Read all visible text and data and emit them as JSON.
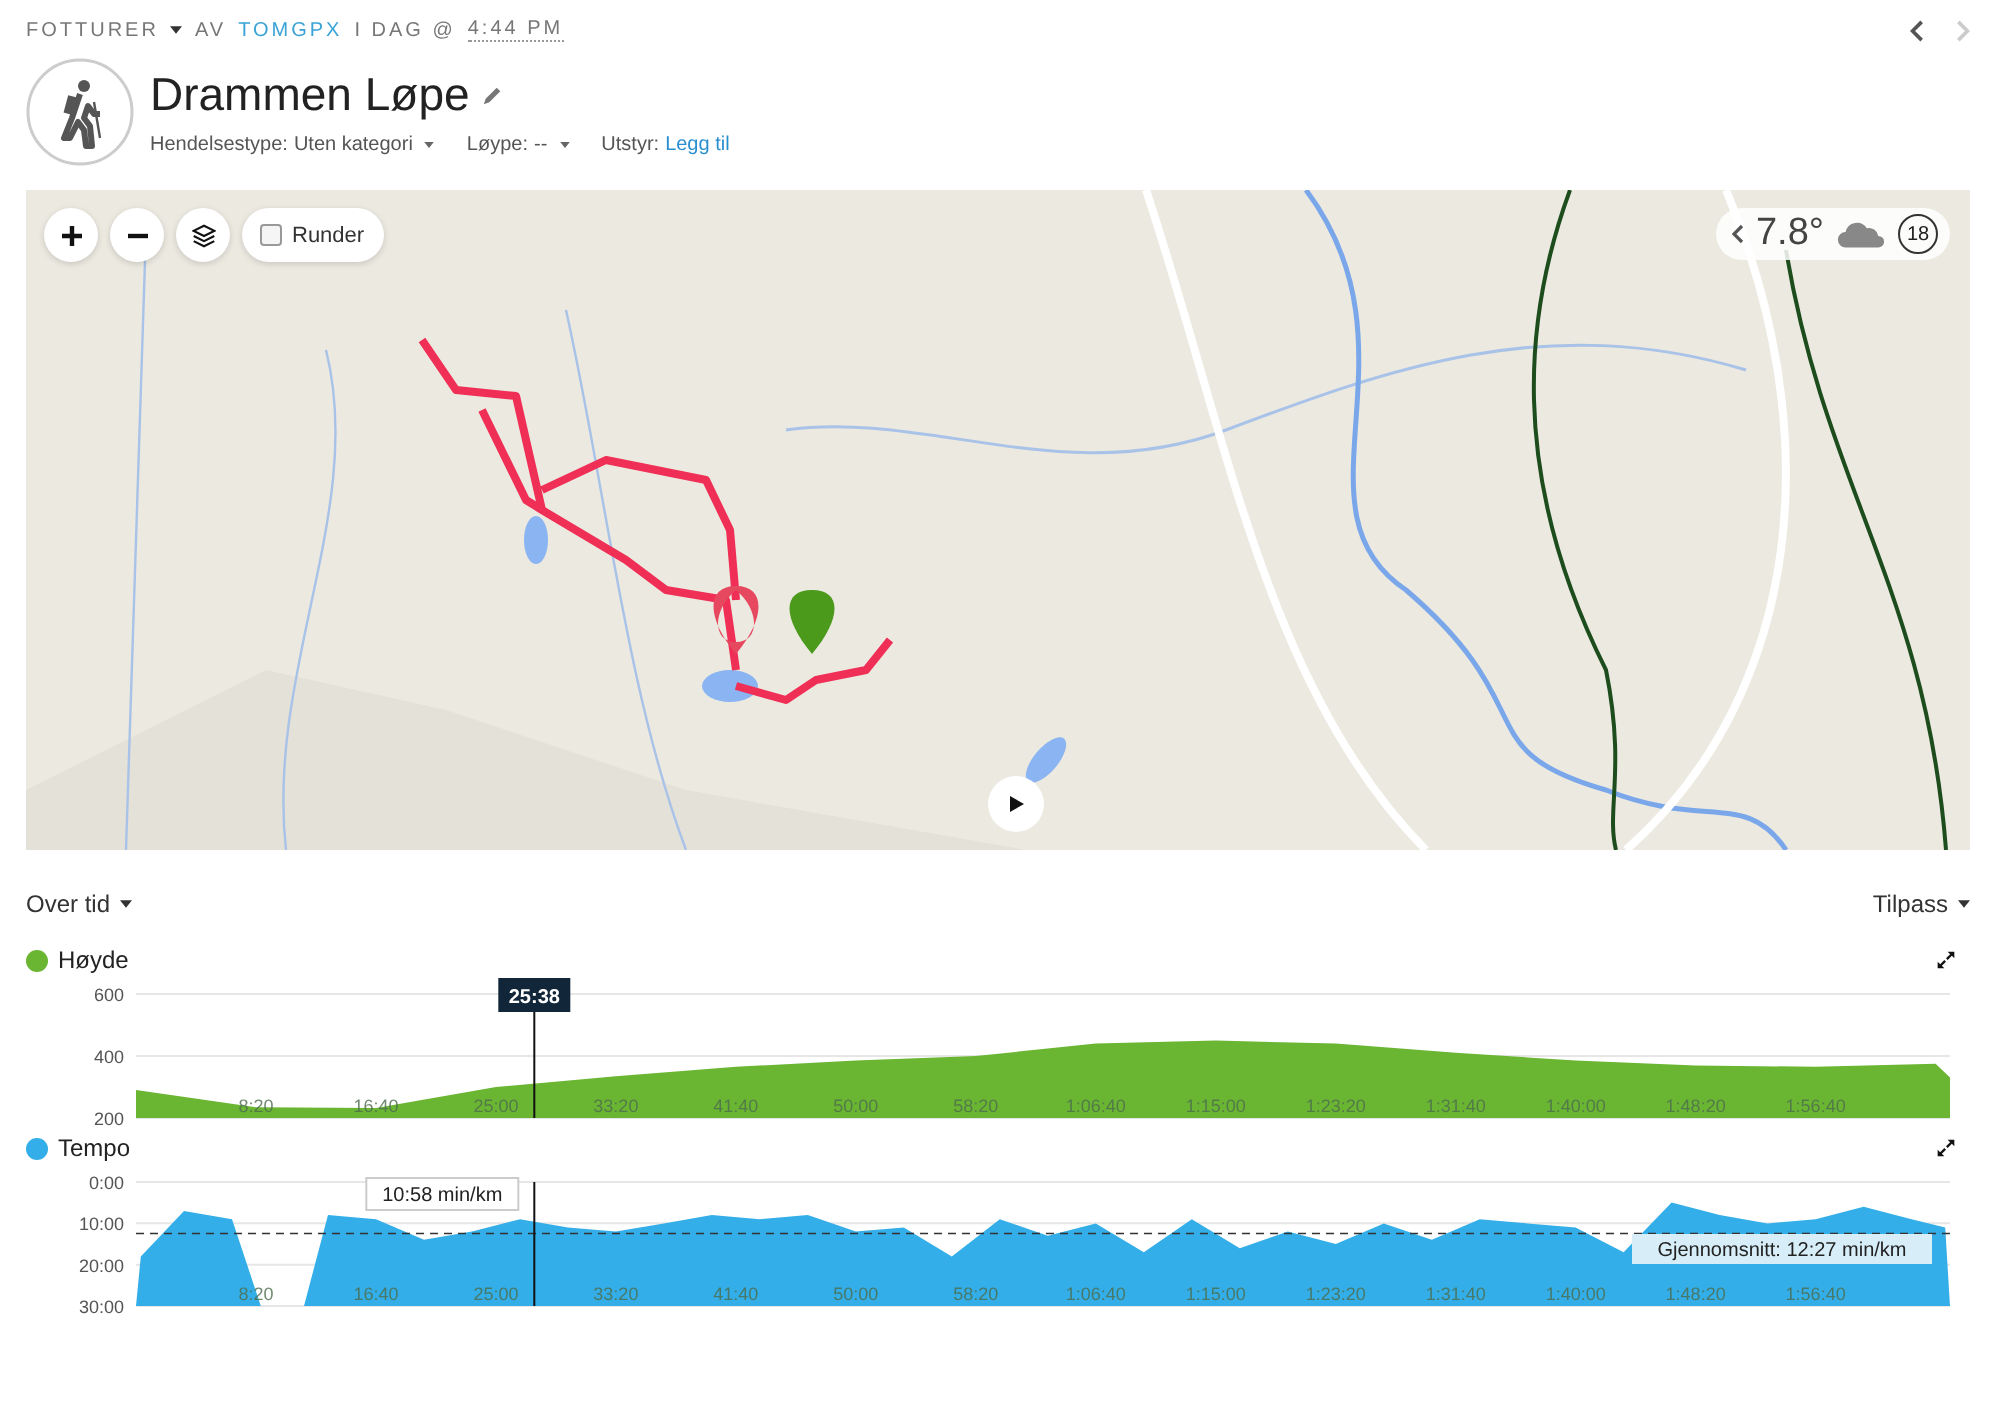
{
  "breadcrumb": {
    "category": "FOTTURER",
    "by": "AV",
    "user": "TOMGPX",
    "when": "I DAG @",
    "time": "4:44 PM"
  },
  "nav": {
    "previous_disabled": false,
    "next_disabled": true
  },
  "activity": {
    "title": "Drammen Løpe",
    "meta": [
      {
        "kind": "dropdown",
        "label": "Hendelsestype:",
        "value": "Uten kategori"
      },
      {
        "kind": "dropdown",
        "label": "Løype:",
        "value": "--"
      },
      {
        "kind": "link",
        "label": "Utstyr:",
        "value": "Legg til"
      }
    ]
  },
  "map": {
    "laps": {
      "label": "Runder",
      "checked": false
    },
    "weather": {
      "temperature": "7.8°",
      "badge": "18"
    }
  },
  "charts_toolbar": {
    "left": "Over tid",
    "right": "Tilpass"
  },
  "charts": [
    {
      "color": "#6ab633",
      "cursor_label": "25:38",
      "chart_data": {
        "type": "area",
        "x": [
          0,
          500,
          1000,
          1500,
          2000,
          2500,
          3000,
          3500,
          4000,
          4500,
          5000,
          5500,
          6000,
          6500,
          7000,
          7500,
          7560
        ],
        "series": [
          {
            "name": "Høyde",
            "color": "#6ab633",
            "values": [
              290,
              235,
              232,
              300,
              335,
              365,
              385,
              400,
              440,
              450,
              440,
              410,
              385,
              370,
              365,
              375,
              330
            ]
          }
        ],
        "xlim": [
          0,
          7560
        ],
        "ylim": [
          200,
          600
        ],
        "yticks": [
          200,
          400,
          600
        ],
        "xticks": [
          {
            "value": 500,
            "label": "8:20"
          },
          {
            "value": 1000,
            "label": "16:40"
          },
          {
            "value": 1500,
            "label": "25:00"
          },
          {
            "value": 2000,
            "label": "33:20"
          },
          {
            "value": 2500,
            "label": "41:40"
          },
          {
            "value": 3000,
            "label": "50:00"
          },
          {
            "value": 3500,
            "label": "58:20"
          },
          {
            "value": 4000,
            "label": "1:06:40"
          },
          {
            "value": 4500,
            "label": "1:15:00"
          },
          {
            "value": 5000,
            "label": "1:23:20"
          },
          {
            "value": 5500,
            "label": "1:31:40"
          },
          {
            "value": 6000,
            "label": "1:40:00"
          },
          {
            "value": 6500,
            "label": "1:48:20"
          },
          {
            "value": 7000,
            "label": "1:56:40"
          }
        ],
        "ref_lines": [
          {
            "axis": "x",
            "value": 1660
          }
        ]
      }
    },
    {
      "color": "#33aee8",
      "cursor_label": "10:58 min/km",
      "average_label": "Gjennomsnitt: 12:27 min/km",
      "chart_data": {
        "type": "area",
        "x": [
          0,
          20,
          200,
          400,
          520,
          700,
          800,
          1000,
          1200,
          1400,
          1600,
          1800,
          2000,
          2200,
          2400,
          2600,
          2800,
          3000,
          3200,
          3400,
          3600,
          3800,
          4000,
          4200,
          4400,
          4600,
          4800,
          5000,
          5200,
          5400,
          5600,
          5800,
          6000,
          6200,
          6400,
          6600,
          6800,
          7000,
          7200,
          7400,
          7540,
          7560
        ],
        "series": [
          {
            "name": "Tempo",
            "color": "#33aee8",
            "values": [
              30,
              18,
              7,
              9,
              30,
              30,
              8,
              9,
              14,
              12,
              9,
              11,
              12,
              10,
              8,
              9,
              8,
              12,
              11,
              18,
              9,
              13,
              10,
              17,
              9,
              16,
              12,
              15,
              10,
              14,
              9,
              10,
              11,
              17,
              5,
              8,
              10,
              9,
              6,
              9,
              11,
              30
            ]
          }
        ],
        "xlim": [
          0,
          7560
        ],
        "ylim": [
          30,
          0
        ],
        "yticks": [
          {
            "value": 0,
            "label": "0:00"
          },
          {
            "value": 10,
            "label": "10:00"
          },
          {
            "value": 20,
            "label": "20:00"
          },
          {
            "value": 30,
            "label": "30:00"
          }
        ],
        "xticks": [
          {
            "value": 500,
            "label": "8:20"
          },
          {
            "value": 1000,
            "label": "16:40"
          },
          {
            "value": 1500,
            "label": "25:00"
          },
          {
            "value": 2000,
            "label": "33:20"
          },
          {
            "value": 2500,
            "label": "41:40"
          },
          {
            "value": 3000,
            "label": "50:00"
          },
          {
            "value": 3500,
            "label": "58:20"
          },
          {
            "value": 4000,
            "label": "1:06:40"
          },
          {
            "value": 4500,
            "label": "1:15:00"
          },
          {
            "value": 5000,
            "label": "1:23:20"
          },
          {
            "value": 5500,
            "label": "1:31:40"
          },
          {
            "value": 6000,
            "label": "1:40:00"
          },
          {
            "value": 6500,
            "label": "1:48:20"
          },
          {
            "value": 7000,
            "label": "1:56:40"
          }
        ],
        "ref_lines": [
          {
            "axis": "x",
            "value": 1660
          },
          {
            "axis": "y",
            "value": 12.45
          }
        ]
      }
    }
  ]
}
